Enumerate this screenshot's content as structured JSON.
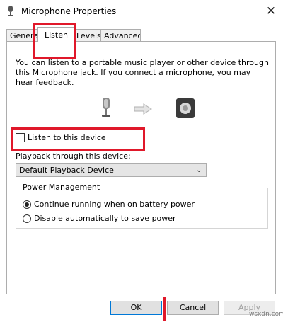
{
  "window": {
    "title": "Microphone Properties",
    "close_label": "✕"
  },
  "tabs": [
    {
      "label": "General"
    },
    {
      "label": "Listen"
    },
    {
      "label": "Levels"
    },
    {
      "label": "Advanced"
    }
  ],
  "tabs_visible": [
    "Genera",
    "Listen",
    "Levels",
    "Advanced"
  ],
  "listen": {
    "description": "You can listen to a portable music player or other device through this Microphone jack.  If you connect a microphone, you may hear feedback.",
    "checkbox_label": "Listen to this device",
    "checkbox_checked": false,
    "playback_label": "Playback through this device:",
    "playback_value": "Default Playback Device"
  },
  "power": {
    "legend": "Power Management",
    "options": [
      {
        "label": "Continue running when on battery power",
        "selected": true
      },
      {
        "label": "Disable automatically to save power",
        "selected": false
      }
    ]
  },
  "buttons": {
    "ok": "OK",
    "cancel": "Cancel",
    "apply": "Apply"
  },
  "icons": {
    "title": "microphone-icon",
    "device_mic": "microphone-icon",
    "arrow": "arrow-right-icon",
    "device_speaker": "speaker-icon"
  },
  "colors": {
    "highlight": "#e0182a",
    "focus_border": "#0078d7"
  },
  "watermark": "wsxdn.com"
}
